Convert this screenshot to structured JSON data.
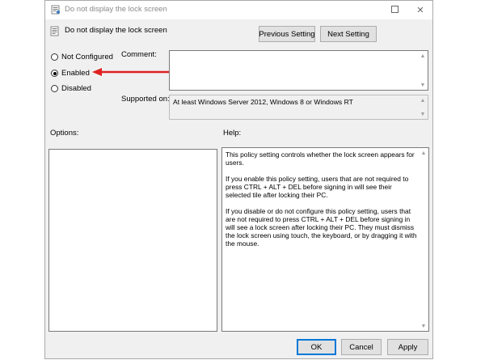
{
  "window": {
    "title": "Do not display the lock screen",
    "controls": {
      "close_symbol": "✕"
    }
  },
  "header": {
    "title": "Do not display the lock screen",
    "previous_button": "Previous Setting",
    "next_button": "Next Setting"
  },
  "state": {
    "options": [
      {
        "label": "Not Configured",
        "checked": false
      },
      {
        "label": "Enabled",
        "checked": true
      },
      {
        "label": "Disabled",
        "checked": false
      }
    ]
  },
  "comment": {
    "label": "Comment:",
    "value": ""
  },
  "supported": {
    "label": "Supported on:",
    "value": "At least Windows Server 2012, Windows 8 or Windows RT"
  },
  "options_section": {
    "label": "Options:"
  },
  "help_section": {
    "label": "Help:",
    "paragraphs": [
      "This policy setting controls whether the lock screen appears for users.",
      "If you enable this policy setting, users that are not required to press CTRL + ALT + DEL before signing in will see their selected tile after locking their PC.",
      "If you disable or do not configure this policy setting, users that are not required to press CTRL + ALT + DEL before signing in will see a lock screen after locking their PC. They must dismiss the lock screen using touch, the keyboard, or by dragging it with the mouse."
    ]
  },
  "footer": {
    "ok": "OK",
    "cancel": "Cancel",
    "apply": "Apply"
  },
  "annotation": {
    "arrow_color": "#e02020",
    "points_to": "Enabled"
  }
}
